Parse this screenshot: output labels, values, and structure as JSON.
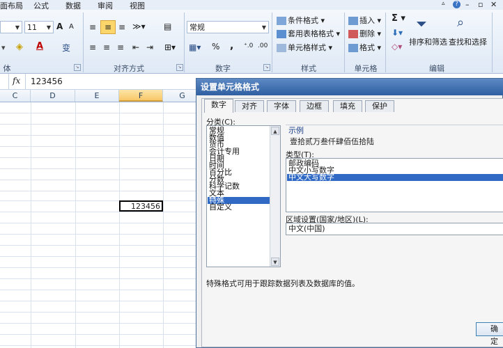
{
  "ribbon_tabs": [
    "面布局",
    "公式",
    "数据",
    "审阅",
    "视图"
  ],
  "ribbon": {
    "font_size": "11",
    "font_grow": "A",
    "font_shrink": "A",
    "font_group_label": "体",
    "alignment_group_label": "对齐方式",
    "number_format_value": "常规",
    "percent_symbol": "%",
    "comma_symbol": ",",
    "number_group_label": "数字",
    "conditional_format": "条件格式",
    "table_format": "套用表格格式",
    "cell_style": "单元格样式",
    "styles_group_label": "样式",
    "insert": "插入",
    "delete": "删除",
    "format": "格式",
    "cells_group_label": "单元格",
    "sum_symbol": "Σ",
    "sort_filter": "排序和筛选",
    "find_select": "查找和选择",
    "editing_group_label": "编辑"
  },
  "formula_bar": {
    "fx": "fx",
    "value": "123456"
  },
  "columns": [
    "C",
    "D",
    "E",
    "F",
    "G"
  ],
  "cell_f": {
    "value": "123456"
  },
  "dialog": {
    "title": "设置单元格格式",
    "tabs": [
      "数字",
      "对齐",
      "字体",
      "边框",
      "填充",
      "保护"
    ],
    "category_label": "分类(C):",
    "categories": [
      "常规",
      "数值",
      "货币",
      "会计专用",
      "日期",
      "时间",
      "百分比",
      "分数",
      "科学记数",
      "文本",
      "特殊",
      "自定义"
    ],
    "selected_category": "特殊",
    "sample_label": "示例",
    "sample_value": "壹拾贰万叁仟肆佰伍拾陆",
    "type_label": "类型(T):",
    "types": [
      "邮政编码",
      "中文小写数字",
      "中文大写数字"
    ],
    "selected_type": "中文大写数字",
    "locale_label": "区域设置(国家/地区)(L):",
    "locale_value": "中文(中国)",
    "description": "特殊格式可用于跟踪数据列表及数据库的值。",
    "ok_label": "确定"
  },
  "colors": {
    "selection": "#316ac5",
    "title_bar": "#2f5fa2",
    "ribbon": "#dfe9f5"
  }
}
